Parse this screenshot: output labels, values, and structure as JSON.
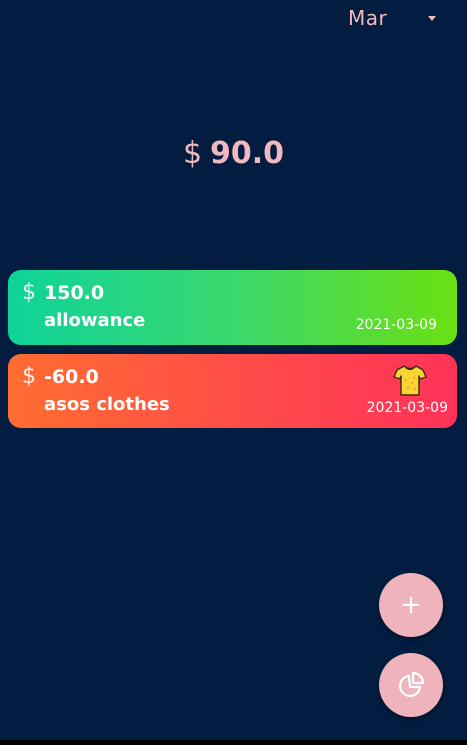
{
  "header": {
    "month": "Mar"
  },
  "balance": {
    "currency": "$",
    "amount": "90.0"
  },
  "transactions": [
    {
      "currency": "$",
      "amount": "150.0",
      "title": "allowance",
      "date": "2021-03-09",
      "icon": null
    },
    {
      "currency": "$",
      "amount": "-60.0",
      "title": "asos clothes",
      "date": "2021-03-09",
      "icon": "tshirt-icon"
    }
  ],
  "actions": {
    "add_label": "+",
    "add_icon": "plus-icon",
    "chart_icon": "pie-chart-icon"
  },
  "colors": {
    "background": "#021d40",
    "accent": "#efb3bb",
    "income_gradient": [
      "#0fd39a",
      "#6be012"
    ],
    "expense_gradient": [
      "#ff6d30",
      "#ff3258"
    ]
  }
}
